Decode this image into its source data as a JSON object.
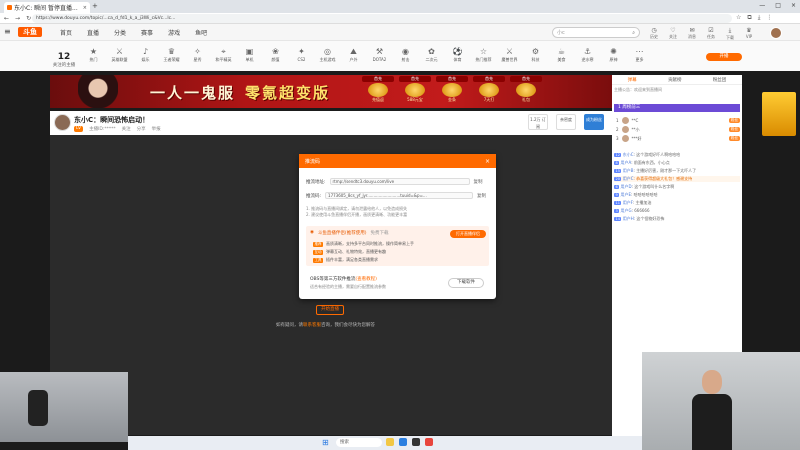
{
  "browser": {
    "tab_title": "东小C: 瞬间 暂停直播...",
    "url": "https://www.douyu.com/topic/...ca_d_fd1_k_a_j3Wi_c&Vc...lc...",
    "controls": [
      "—",
      "□",
      "×"
    ],
    "nav": [
      "←",
      "→",
      "↻"
    ]
  },
  "site": {
    "logo": "斗鱼",
    "nav": [
      "首页",
      "直播",
      "分类",
      "赛事",
      "游戏",
      "鱼吧"
    ],
    "search_placeholder": "小c",
    "user_icons": [
      {
        "icon": "history-icon",
        "label": "历史"
      },
      {
        "icon": "follow-icon",
        "label": "关注"
      },
      {
        "icon": "message-icon",
        "label": "消息"
      },
      {
        "icon": "task-icon",
        "label": "任务"
      },
      {
        "icon": "download-icon",
        "label": "下载"
      },
      {
        "icon": "vip-icon",
        "label": "VIP"
      }
    ],
    "follow_count": "12",
    "follow_label": "关注的主播",
    "categories": [
      "热门",
      "英雄联盟",
      "娱乐",
      "王者荣耀",
      "星秀",
      "和平精英",
      "单机",
      "颜值",
      "CS2",
      "主机游戏",
      "户外",
      "DOTA2",
      "射击",
      "二次元",
      "体育",
      "热门推荐",
      "魔兽世界",
      "科技",
      "美食",
      "逆水寒",
      "原神",
      "更多"
    ],
    "start_live": "开播"
  },
  "banner": {
    "title": "一人一鬼服",
    "subtitle": "零氪超变版",
    "rewards": [
      {
        "label": "首充",
        "amount": "充值返"
      },
      {
        "label": "首充",
        "amount": "588元宝"
      },
      {
        "label": "首充",
        "amount": "金条"
      },
      {
        "label": "首充",
        "amount": "7天打"
      },
      {
        "label": "首充",
        "amount": "礼包"
      }
    ]
  },
  "room": {
    "title": "东小C：瞬间恐怖启动！",
    "level_tag": "LV",
    "meta": [
      "主播ID:*****",
      "关注",
      "分享",
      "举报"
    ],
    "follow_tag": "关注",
    "right_buttons": [
      "1.2万 订阅",
      "亲密度",
      "成为粉丝"
    ]
  },
  "modal": {
    "title": "推流码",
    "server_label": "推流地址:",
    "server_value": "rtmp://sendtc3.douyu.com/live",
    "key_label": "推流码:",
    "key_value": "1773605_8cs_yf_jyr..........................tuuid=&p=...",
    "copy_label": "复制",
    "note_1": "1. 推流码与直播间绑定，请勿泄露给他人，以免造成损失",
    "note_2": "2. 建议使用斗鱼直播伴侣开播，画质更清晰、功能更丰富",
    "box_title": "斗鱼直播伴侣(推荐使用)",
    "box_badge": "免费下载",
    "box_button": "打开直播伴侣",
    "box_lines": [
      {
        "tag": "推荐",
        "text": "画质清晰，支持多平台同时推流，操作简单易上手"
      },
      {
        "tag": "互动",
        "text": "弹幕互动、礼物特效，直播更有趣"
      },
      {
        "tag": "工具",
        "text": "插件丰富，满足各类直播需求"
      }
    ],
    "footer_title": "OBS等第三方软件推流",
    "footer_link": "(查看教程)",
    "footer_sub": "适合有经验的主播，需要自行配置推流参数",
    "download_button": "下载软件"
  },
  "player": {
    "button": "开始直播",
    "hint_prefix": "如有疑问，请",
    "hint_link": "联系客服",
    "hint_suffix": "咨询，我们会尽快为您解答"
  },
  "chat": {
    "tabs": [
      "弹幕",
      "贡献榜",
      "粉丝团"
    ],
    "active_tab": "弹幕",
    "subtitle": "主播公告：欢迎来到直播间",
    "banner": "1 周榜前三",
    "rank": [
      {
        "name": "**C",
        "badge": "粉丝"
      },
      {
        "name": "**小",
        "badge": "粉丝"
      },
      {
        "name": "***好",
        "badge": "粉丝"
      }
    ],
    "messages": [
      {
        "lv": "12",
        "name": "东小C",
        "text": "这个游戏好吓人啊哈哈哈",
        "hot": false
      },
      {
        "lv": "8",
        "name": "用户A",
        "text": "前面有东西，小心点",
        "hot": false
      },
      {
        "lv": "15",
        "name": "用户B",
        "text": "主播好厉害，刚才那一下太吓人了",
        "hot": false
      },
      {
        "lv": "20",
        "name": "用户C",
        "text": "恭喜获得超级大礼包！感谢支持",
        "hot": true
      },
      {
        "lv": "6",
        "name": "用户D",
        "text": "这个游戏叫什么名字啊",
        "hot": false
      },
      {
        "lv": "9",
        "name": "用户E",
        "text": "哈哈哈哈哈哈",
        "hot": false
      },
      {
        "lv": "11",
        "name": "用户F",
        "text": "主播加油",
        "hot": false
      },
      {
        "lv": "3",
        "name": "用户G",
        "text": "666666",
        "hot": false
      },
      {
        "lv": "14",
        "name": "用户H",
        "text": "这个怪物好恐怖",
        "hot": false
      }
    ]
  },
  "taskbar": {
    "search": "搜索"
  }
}
